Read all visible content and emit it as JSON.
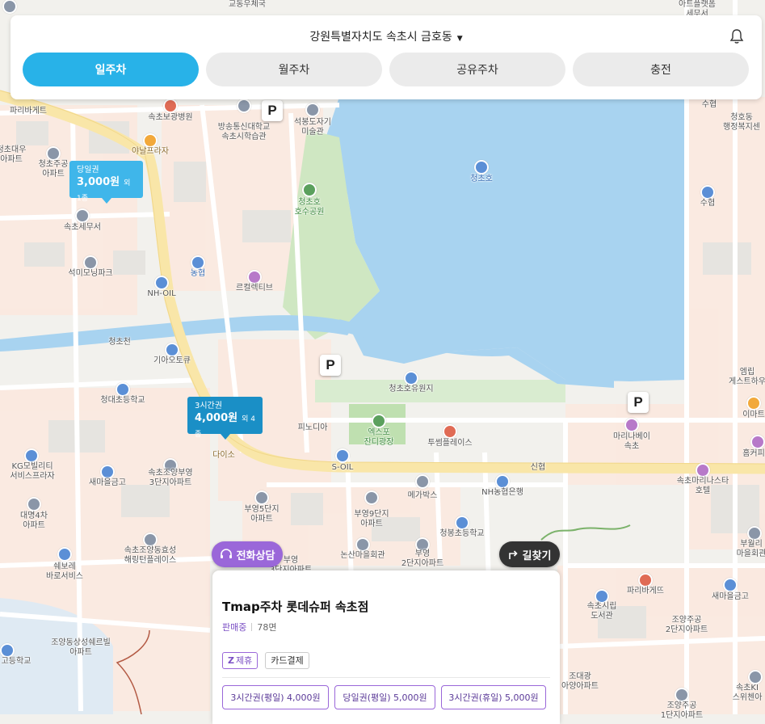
{
  "header": {
    "region": "강원특별자치도 속초시 금호동",
    "bell_icon": "bell-icon"
  },
  "tabs": [
    {
      "label": "일주차",
      "active": true
    },
    {
      "label": "월주차",
      "active": false
    },
    {
      "label": "공유주차",
      "active": false
    },
    {
      "label": "충전",
      "active": false
    }
  ],
  "colors": {
    "accent": "#28b2e8",
    "purple": "#9a67d9",
    "water": "#a8d3f0",
    "park": "#cfe7c2",
    "main_road": "#f9e6a8"
  },
  "price_markers": [
    {
      "label": "당일권",
      "price": "3,000원",
      "extra": "외 1종"
    },
    {
      "label": "3시간권",
      "price": "4,000원",
      "extra": "외 4종"
    }
  ],
  "map_labels": {
    "l1": "교동우체국",
    "l2": "아트플랫폼\n세무서",
    "l3": "파리바게트",
    "l4": "속초보광병원",
    "l5": "방송통신대학교\n속초시학습관",
    "l6": "석봉도자기\n미술관",
    "l7": "수협",
    "l8": "청호동\n행정복지센",
    "l9": "야날프라자",
    "l10": "청초대우\n아파트",
    "l11": "청초주공\n아파트",
    "l12": "청초호",
    "l13": "청초호\n호수공원",
    "l14": "수협",
    "l15": "속초세무서",
    "l16": "농협",
    "l17": "석미모닝파크",
    "l18": "NH-OIL",
    "l19": "르컬렉티브",
    "l20": "청초천",
    "l21": "기아오토큐",
    "l22": "청초호유원지",
    "l23": "청대초등학교",
    "l24": "엑스포\n잔디광장",
    "l25": "피노디아",
    "l26": "투썸플레이스",
    "l27": "마리나베이\n속초",
    "l28": "엠립\n게스트하우",
    "l29": "이마트",
    "l30": "다이소",
    "l31": "S-OIL",
    "l32": "신협",
    "l33": "KG모빌리티\n서비스프라자",
    "l34": "새마을금고",
    "l35": "속초조양부영\n3단지아파트",
    "l36": "메가박스",
    "l37": "NH농협은행",
    "l38": "속초마리나스타\n호텔",
    "l39": "홈커피",
    "l40": "대명4차\n아파트",
    "l41": "부영5단지\n아파트",
    "l42": "부영9단지\n아파트",
    "l43": "청봉초등학교",
    "l44": "속초조양동효성\n해링턴플레이스",
    "l45": "논산마을회관",
    "l46": "부영\n2단지아파트",
    "l47": "쉐보레\n바로서비스",
    "l48": "부영\n3단지아파트",
    "l49": "파리바게뜨",
    "l50": "속초시립\n도서관",
    "l51": "새마을금고",
    "l52": "부월리\n마을회관",
    "l53": "조양동상성쉐르빌\n아파트",
    "l54": "조양주공\n2단지아파트",
    "l55": "고등학교",
    "l56": "조대광\n아양아파트",
    "l57": "속초KI\n스위첸아",
    "l58": "조양주공\n1단지아파트"
  },
  "phone_button": {
    "label": "전화상담",
    "icon": "headset-icon"
  },
  "route_button": {
    "label": "길찾기",
    "icon": "turn-right-arrow-icon"
  },
  "card": {
    "name": "Tmap주차 롯데슈퍼 속초점",
    "status": "판매중",
    "count": "78면",
    "badges": [
      "제휴",
      "카드결제"
    ],
    "tickets": [
      "3시간권(평일) 4,000원",
      "당일권(평일) 5,000원",
      "3시간권(휴일) 5,000원"
    ]
  }
}
